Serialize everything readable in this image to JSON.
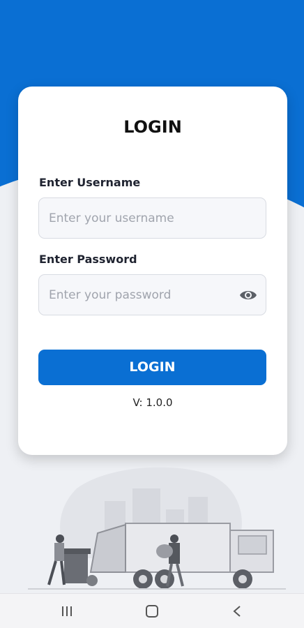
{
  "login": {
    "title": "LOGIN",
    "username_label": "Enter Username",
    "username_placeholder": "Enter your username",
    "username_value": "",
    "password_label": "Enter Password",
    "password_placeholder": "Enter your password",
    "password_value": "",
    "button_label": "LOGIN",
    "version": "V: 1.0.0"
  },
  "icons": {
    "password_toggle": "eye-icon",
    "nav_recents": "recents-icon",
    "nav_home": "home-icon",
    "nav_back": "back-icon"
  },
  "colors": {
    "primary": "#0a6fd3",
    "background": "#eef0f4",
    "card": "#ffffff"
  }
}
